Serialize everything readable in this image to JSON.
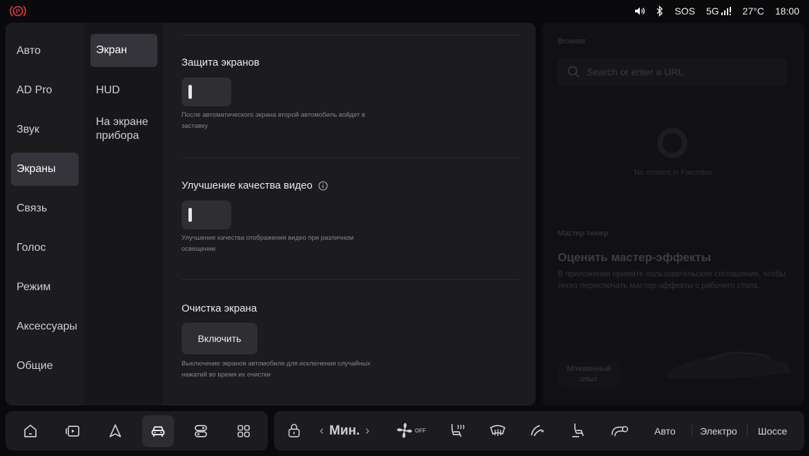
{
  "status_bar": {
    "parking_brake_icon": "parking-brake-icon",
    "parking_brake_color": "#d83a3a",
    "sos": "SOS",
    "network": "5G",
    "temperature": "27°C",
    "time": "18:00"
  },
  "nav_primary": {
    "items": [
      {
        "label": "Авто"
      },
      {
        "label": "AD Pro"
      },
      {
        "label": "Звук"
      },
      {
        "label": "Экраны",
        "active": true
      },
      {
        "label": "Связь"
      },
      {
        "label": "Голос"
      },
      {
        "label": "Режим"
      },
      {
        "label": "Аксессуары"
      },
      {
        "label": "Общие"
      }
    ]
  },
  "nav_secondary": {
    "items": [
      {
        "label": "Экран",
        "active": true
      },
      {
        "label": "HUD"
      },
      {
        "label": "На экране прибора"
      }
    ]
  },
  "content": {
    "screen_protection": {
      "title": "Защита экранов",
      "enabled": false,
      "description": "После автоматического экрана второй автомобиль войдет в заставку"
    },
    "video_enhancement": {
      "title": "Улучшение качества видео",
      "enabled": false,
      "description": "Улучшение качества отображения видео при различном освещении"
    },
    "screen_cleaning": {
      "title": "Очистка экрана",
      "button_label": "Включить",
      "description": "Выключение экранов автомобиля для исключения случайных нажатий во время их очистки"
    }
  },
  "right_panel": {
    "browser_label": "Browser",
    "search_placeholder": "Search or enter a URL",
    "empty_text": "No content in Favorites",
    "tuner_label": "Мастер-тюнер",
    "tuner_heading": "Оценить мастер-эффекты",
    "tuner_text": "В приложении примите пользовательское соглашение, чтобы легко переключать мастер-эффекты с рабочего стола.",
    "instant_button": "Мгновенный опыт"
  },
  "dock": {
    "apps": [
      {
        "icon": "home-icon"
      },
      {
        "icon": "media-icon"
      },
      {
        "icon": "navigation-icon"
      },
      {
        "icon": "car-icon",
        "active": true
      },
      {
        "icon": "toggle-apps-icon"
      },
      {
        "icon": "app-grid-icon"
      }
    ]
  },
  "climate": {
    "fan_level": "Мин.",
    "fan_state": "OFF",
    "modes": [
      "Авто",
      "Электро",
      "Шоссе"
    ]
  },
  "colors": {
    "panel": "#1c1c1f",
    "active_item": "#34343a",
    "accent_red": "#d83a3a"
  }
}
